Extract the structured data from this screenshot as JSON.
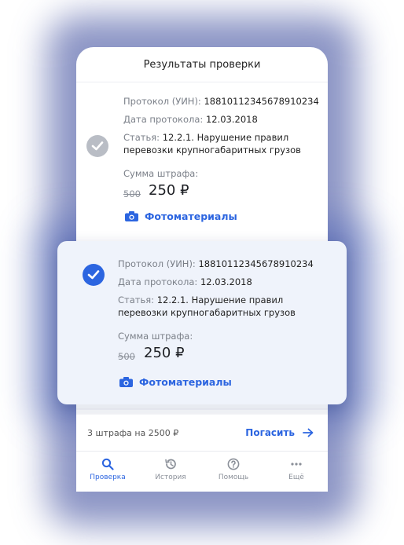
{
  "header": {
    "title": "Результаты проверки"
  },
  "card_back": {
    "protocol_label": "Протокол (УИН):",
    "protocol_value": "18810112345678910234",
    "date_label": "Дата протокола:",
    "date_value": "12.03.2018",
    "article_label": "Статья:",
    "article_line1": "12.2.1. Нарушение правил",
    "article_line2": "перевозки крупногабаритных грузов",
    "fine_label": "Сумма штрафа:",
    "old_amount": "500",
    "amount": "250 ₽",
    "photos_label": "Фотоматериалы",
    "selected": false
  },
  "card_front": {
    "protocol_label": "Протокол (УИН):",
    "protocol_value": "18810112345678910234",
    "date_label": "Дата протокола:",
    "date_value": "12.03.2018",
    "article_label": "Статья:",
    "article_line1": "12.2.1. Нарушение правил",
    "article_line2": "перевозки крупногабаритных грузов",
    "fine_label": "Сумма штрафа:",
    "old_amount": "500",
    "amount": "250 ₽",
    "photos_label": "Фотоматериалы",
    "selected": true
  },
  "paybar": {
    "summary": "3 штрафа на 2500 ₽",
    "pay_label": "Погасить"
  },
  "tabs": [
    {
      "label": "Проверка",
      "icon": "search-icon",
      "active": true
    },
    {
      "label": "История",
      "icon": "history-icon",
      "active": false
    },
    {
      "label": "Помощь",
      "icon": "help-icon",
      "active": false
    },
    {
      "label": "Ещё",
      "icon": "more-icon",
      "active": false
    }
  ],
  "colors": {
    "accent": "#2c65e0",
    "check_inactive": "#b9bdc5",
    "popup_bg": "#eff3fb"
  }
}
